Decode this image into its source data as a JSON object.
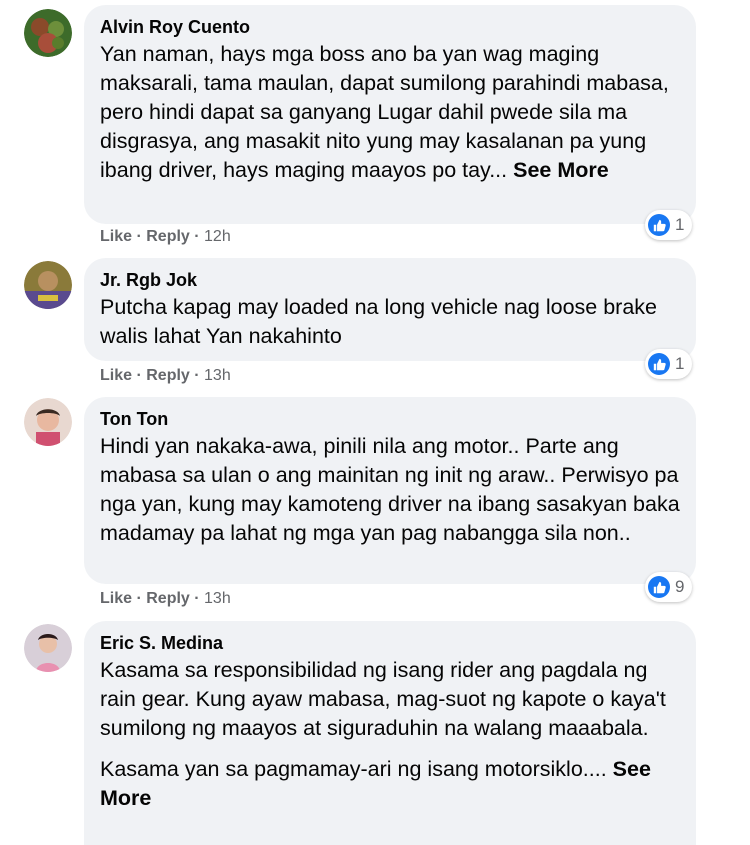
{
  "comments": [
    {
      "author": "Alvin Roy Cuento",
      "text": "Yan naman, hays mga boss ano ba yan wag maging maksarali, tama maulan, dapat sumilong parahindi mabasa, pero hindi dapat sa ganyang Lugar dahil pwede sila ma disgrasya, ang masakit nito yung may kasalanan pa yung ibang driver, hays maging maayos po tay...",
      "see_more": "See More",
      "like": "Like",
      "reply": "Reply",
      "time": "12h",
      "reactions": "1"
    },
    {
      "author": "Jr. Rgb Jok",
      "text": "Putcha kapag may loaded na long vehicle nag loose brake walis lahat Yan nakahinto",
      "like": "Like",
      "reply": "Reply",
      "time": "13h",
      "reactions": "1"
    },
    {
      "author": "Ton Ton",
      "text": "Hindi yan nakaka-awa, pinili nila ang motor.. Parte ang mabasa sa ulan o ang mainitan ng init ng araw.. Perwisyo pa nga yan, kung may kamoteng driver na ibang sasakyan baka madamay pa lahat ng mga yan pag nabangga sila non..",
      "like": "Like",
      "reply": "Reply",
      "time": "13h",
      "reactions": "9"
    },
    {
      "author": "Eric S. Medina",
      "text": "Kasama sa responsibilidad ng isang rider ang pagdala ng rain gear. Kung ayaw mabasa, mag-suot ng kapote o kaya't sumilong ng maayos at siguraduhin na walang maaabala.",
      "text2": "Kasama yan sa pagmamay-ari ng isang motorsiklo....",
      "see_more": "See More"
    }
  ],
  "colors": {
    "bubble": "#f0f2f5",
    "meta": "#65676b",
    "like_blue": "#1877f2"
  },
  "icons": {
    "reaction": "thumbs-up-icon"
  }
}
